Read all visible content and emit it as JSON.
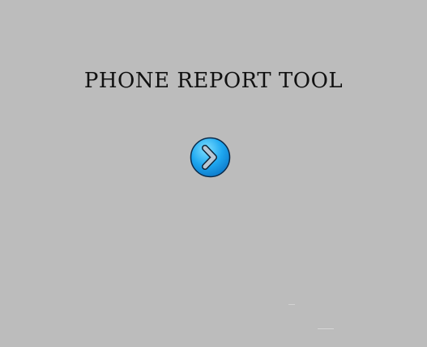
{
  "app": {
    "title": "PHONE REPORT TOOL"
  },
  "start_button": {
    "icon": "chevron-right-icon",
    "color": "#1ea7f0",
    "border_color": "#0a2a4a"
  },
  "background_color": "#bcbcbc"
}
